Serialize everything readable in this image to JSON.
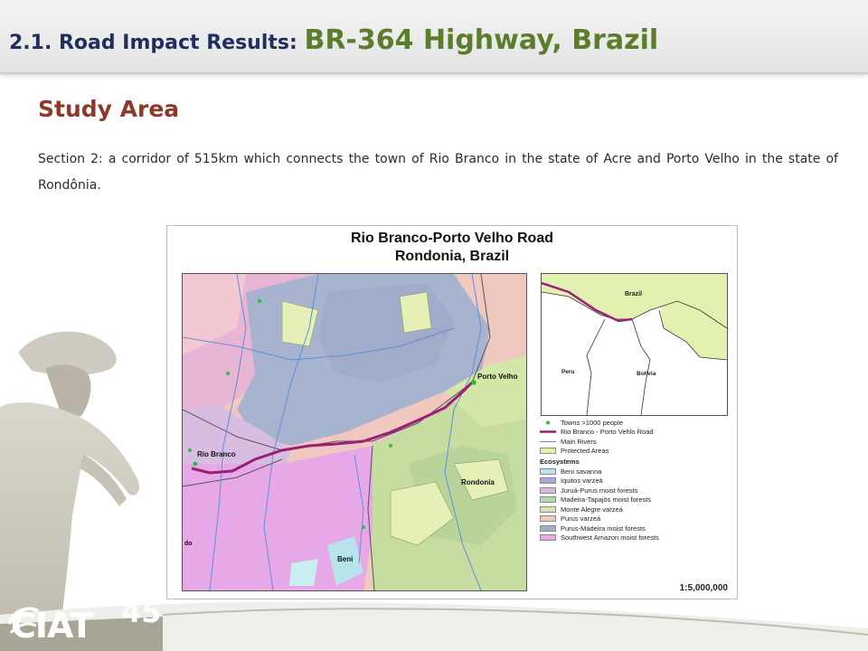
{
  "header": {
    "title_prefix": "2.1.  Road Impact Results: ",
    "title_main": "BR-364 Highway, Brazil"
  },
  "section": {
    "heading": "Study Area",
    "text": "Section 2: a corridor of 515km which connects the town of Rio Branco in the state of Acre and Porto Velho in the state of Rondônia."
  },
  "map": {
    "title_line1": "Rio Branco-Porto Velho Road",
    "title_line2": "Rondonia, Brazil",
    "labels": {
      "rio_branco": "Rio Branco",
      "porto_velho": "Porto Velho",
      "rondonia": "Rondonia",
      "beni": "Beni",
      "do": "do"
    },
    "inset_labels": {
      "brazil": "Brazil",
      "peru": "Peru",
      "bolivia": "Bolivia"
    },
    "legend": {
      "towns": "Towns >1000 people",
      "road": "Rio Branco - Porto Vehlo Road",
      "rivers": "Main Rivers",
      "protected": "Protected Areas",
      "ecosystems_heading": "Ecosystems",
      "ecosystems": [
        {
          "name": "Beni savanna",
          "color": "#b8e4ec"
        },
        {
          "name": "Iquitos varzeá",
          "color": "#a8a8d8"
        },
        {
          "name": "Juruá-Purus moist forests",
          "color": "#d8b8dc"
        },
        {
          "name": "Madeira-Tapajós moist forests",
          "color": "#b8d8a8"
        },
        {
          "name": "Monte Alegre varzeá",
          "color": "#d8e8a8"
        },
        {
          "name": "Purus varzeá",
          "color": "#f0c8c0"
        },
        {
          "name": "Purus-Madeira moist forests",
          "color": "#a0b0cc"
        },
        {
          "name": "Southwest Amazon moist forests",
          "color": "#e8a8e8"
        }
      ]
    },
    "scale": "1:5,000,000",
    "colors": {
      "road": "#9a1f7a",
      "rivers": "#5f8fd8",
      "towns": "#2bbf3a",
      "protected": "#e6efb8"
    }
  },
  "footer": {
    "logo_text": "CIAT",
    "logo_number": "45"
  },
  "colors": {
    "title_prefix": "#1f2f5e",
    "title_main": "#5c7e2c",
    "heading": "#8d3a2a"
  }
}
